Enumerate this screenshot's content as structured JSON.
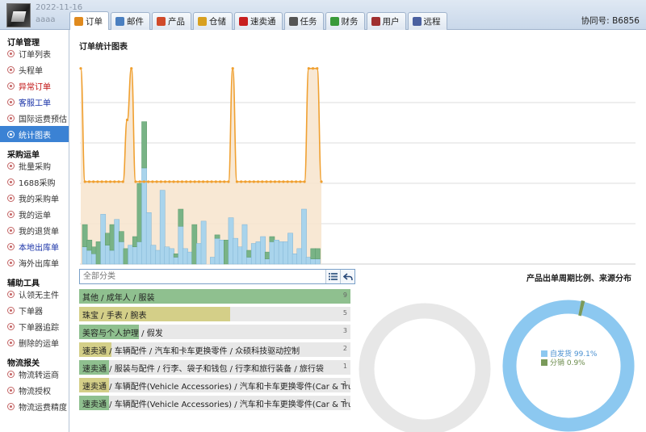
{
  "user": {
    "date": "2022-11-16",
    "name": "aaaa"
  },
  "tabs": [
    {
      "label": "订单",
      "icon": "order-icon",
      "color": "#e08a1e",
      "active": true
    },
    {
      "label": "邮件",
      "icon": "mail-icon",
      "color": "#4a7fc0",
      "active": false
    },
    {
      "label": "产品",
      "icon": "product-icon",
      "color": "#d04a2a",
      "active": false
    },
    {
      "label": "仓储",
      "icon": "warehouse-icon",
      "color": "#d8a020",
      "active": false
    },
    {
      "label": "速卖通",
      "icon": "aliexpress-icon",
      "color": "#c82020",
      "active": false
    },
    {
      "label": "任务",
      "icon": "task-icon",
      "color": "#555555",
      "active": false
    },
    {
      "label": "财务",
      "icon": "finance-icon",
      "color": "#3a9a3a",
      "active": false
    },
    {
      "label": "用户",
      "icon": "user-icon",
      "color": "#a03030",
      "active": false
    },
    {
      "label": "远程",
      "icon": "remote-icon",
      "color": "#4a60a0",
      "active": false
    }
  ],
  "assist": "协同号: B6856",
  "sidebar": [
    {
      "title": "订单管理",
      "items": [
        {
          "label": "订单列表",
          "style": ""
        },
        {
          "label": "头程单",
          "style": ""
        },
        {
          "label": "异常订单",
          "style": "red"
        },
        {
          "label": "客服工单",
          "style": "blue"
        },
        {
          "label": "国际运费预估",
          "style": ""
        },
        {
          "label": "统计图表",
          "style": "active"
        }
      ]
    },
    {
      "title": "采购运单",
      "items": [
        {
          "label": "批量采购",
          "style": ""
        },
        {
          "label": "1688采购",
          "style": ""
        },
        {
          "label": "我的采购单",
          "style": ""
        },
        {
          "label": "我的运单",
          "style": ""
        },
        {
          "label": "我的退货单",
          "style": ""
        },
        {
          "label": "本地出库单",
          "style": "blue"
        },
        {
          "label": "海外出库单",
          "style": ""
        }
      ]
    },
    {
      "title": "辅助工具",
      "items": [
        {
          "label": "认领无主件",
          "style": ""
        },
        {
          "label": "下单器",
          "style": ""
        },
        {
          "label": "下单器追踪",
          "style": ""
        },
        {
          "label": "删除的运单",
          "style": ""
        }
      ]
    },
    {
      "title": "物流报关",
      "items": [
        {
          "label": "物流转运商",
          "style": ""
        },
        {
          "label": "物流授权",
          "style": ""
        },
        {
          "label": "物流运费精度",
          "style": ""
        }
      ]
    }
  ],
  "chart_title": "订单统计图表",
  "category_search": {
    "placeholder": "全部分类"
  },
  "categories": [
    {
      "label": "其他 / 成年人 / 服装",
      "count": "9",
      "fill": 1.0,
      "color": "#8fc08f"
    },
    {
      "label": "珠宝 / 手表 / 腕表",
      "count": "5",
      "fill": 0.556,
      "color": "#d4cf88"
    },
    {
      "label": "美容与个人护理 / 假发",
      "count": "3",
      "fill": 0.22,
      "color": "#8fc08f"
    },
    {
      "label": "速卖通 / 车辆配件 / 汽车和卡车更换零件 / 众硕科技驱动控制",
      "count": "2",
      "fill": 0.12,
      "color": "#d4cf88"
    },
    {
      "label": "速卖通 / 服装与配件 / 行李、袋子和钱包 / 行李和旅行装备 / 旅行袋",
      "count": "1",
      "fill": 0.11,
      "color": "#8fc08f"
    },
    {
      "label": "速卖通 / 车辆配件(Vehicle Accessories) / 汽车和卡车更换零件(Car & Truck Replacement Parts)",
      "count": "1",
      "fill": 0.11,
      "color": "#d4cf88"
    },
    {
      "label": "速卖通 / 车辆配件(Vehicle Accessories) / 汽车和卡车更换零件(Car & Truck Replacement Parts)",
      "count": "1",
      "fill": 0.11,
      "color": "#8fc08f"
    }
  ],
  "pie_title": "产品出单周期比例、来源分布",
  "source_legend": [
    {
      "label": "自发货 99.1%",
      "color": "#8cc8f0",
      "value": 99.1
    },
    {
      "label": "分销 0.9%",
      "color": "#7a9a5a",
      "value": 0.9
    }
  ],
  "chart_data": {
    "type": "bar",
    "bar_colors": {
      "blue": "#a9d4ec",
      "green": "#79b386",
      "line": "#f0a030",
      "area": "#f7e4cc"
    },
    "bars": [
      [
        10,
        13
      ],
      [
        8,
        6
      ],
      [
        6,
        4
      ],
      [
        0,
        13
      ],
      [
        29,
        0
      ],
      [
        11,
        7
      ],
      [
        8,
        15
      ],
      [
        26,
        0
      ],
      [
        13,
        6
      ],
      [
        0,
        9
      ],
      [
        11,
        0
      ],
      [
        10,
        6
      ],
      [
        13,
        34
      ],
      [
        56,
        27
      ],
      [
        30,
        0
      ],
      [
        11,
        0
      ],
      [
        8,
        0
      ],
      [
        43,
        0
      ],
      [
        10,
        0
      ],
      [
        9,
        0
      ],
      [
        4,
        2
      ],
      [
        22,
        10
      ],
      [
        9,
        0
      ],
      [
        7,
        0
      ],
      [
        0,
        23
      ],
      [
        12,
        0
      ],
      [
        25,
        0
      ],
      [
        0,
        0
      ],
      [
        4,
        0
      ],
      [
        15,
        2
      ],
      [
        14,
        0
      ],
      [
        0,
        14
      ],
      [
        27,
        0
      ],
      [
        15,
        0
      ],
      [
        10,
        0
      ],
      [
        23,
        0
      ],
      [
        4,
        4
      ],
      [
        12,
        0
      ],
      [
        13,
        0
      ],
      [
        16,
        0
      ],
      [
        3,
        4
      ],
      [
        13,
        3
      ],
      [
        14,
        0
      ],
      [
        13,
        0
      ],
      [
        13,
        0
      ],
      [
        18,
        0
      ],
      [
        6,
        0
      ],
      [
        9,
        0
      ],
      [
        32,
        0
      ],
      [
        4,
        0
      ],
      [
        3,
        6
      ],
      [
        3,
        6
      ]
    ],
    "line": [
      95,
      40,
      40,
      40,
      40,
      40,
      40,
      40,
      40,
      40,
      40,
      70,
      95,
      40,
      40,
      40,
      40,
      40,
      40,
      40,
      40,
      40,
      40,
      40,
      40,
      40,
      40,
      40,
      40,
      40,
      40,
      40,
      40,
      40,
      40,
      40,
      95,
      40,
      40,
      40,
      40,
      40,
      40,
      40,
      40,
      40,
      40,
      40,
      40,
      40,
      40,
      40,
      40,
      40,
      95,
      95,
      95,
      40
    ]
  }
}
